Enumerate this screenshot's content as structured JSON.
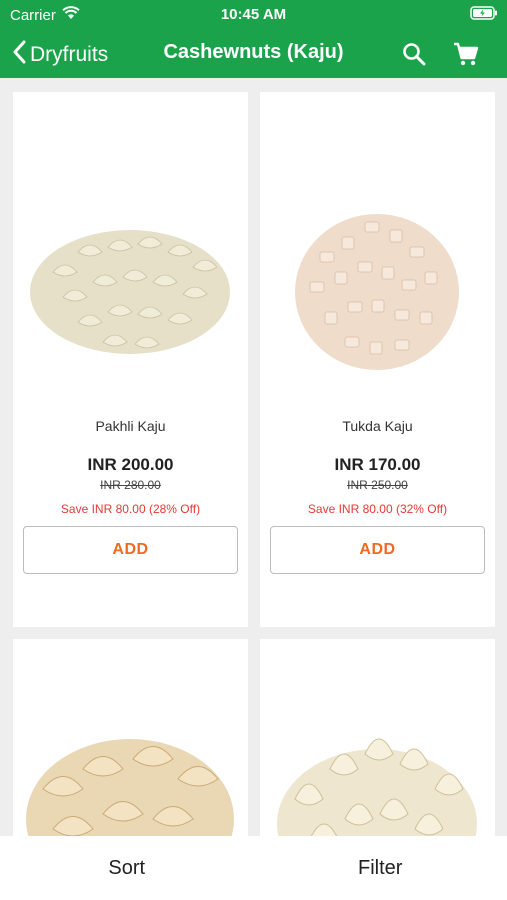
{
  "status_bar": {
    "carrier": "Carrier",
    "time": "10:45 AM"
  },
  "nav": {
    "back_label": "Dryfruits",
    "title": "Cashewnuts (Kaju)",
    "icons": [
      "search-icon",
      "cart-icon"
    ]
  },
  "products": [
    {
      "name": "Pakhli Kaju",
      "price": "INR 200.00",
      "mrp": "INR 280.00",
      "savings": "Save INR 80.00 (28% Off)",
      "add_label": "ADD"
    },
    {
      "name": "Tukda Kaju",
      "price": "INR 170.00",
      "mrp": "INR 250.00",
      "savings": "Save INR 80.00 (32% Off)",
      "add_label": "ADD"
    }
  ],
  "bottom_bar": {
    "sort_label": "Sort",
    "filter_label": "Filter"
  },
  "colors": {
    "header": "#1aa34a",
    "add_text": "#f06a1f",
    "savings_text": "#e53935"
  }
}
